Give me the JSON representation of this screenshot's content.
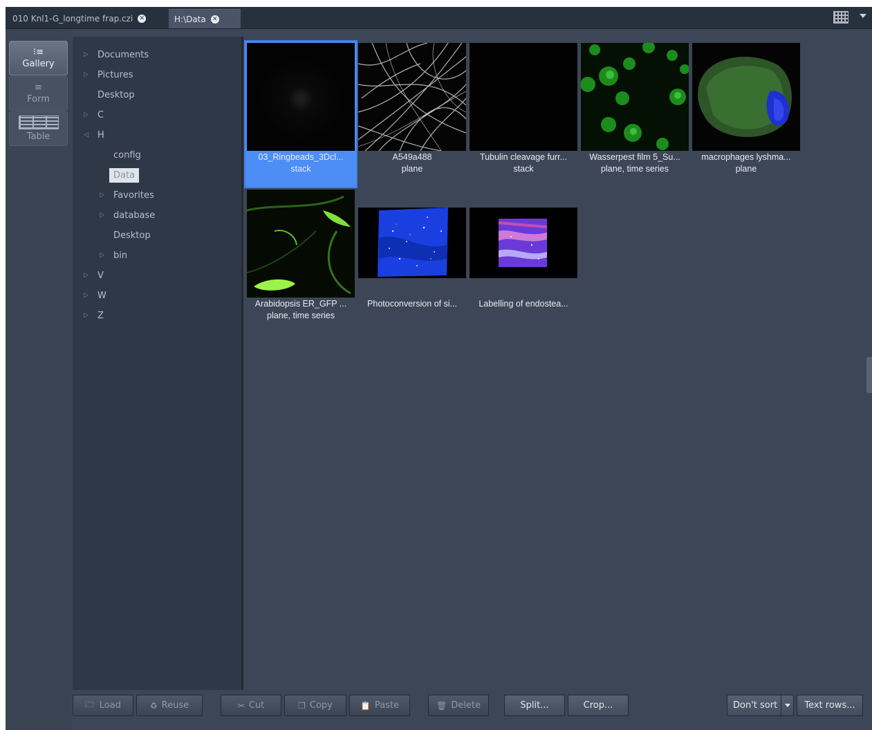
{
  "tabs": [
    {
      "label": "010 Knl1-G_longtime frap.czi"
    },
    {
      "label": "H:\\Data"
    }
  ],
  "view_modes": [
    {
      "label": "Gallery"
    },
    {
      "label": "Form"
    },
    {
      "label": "Table"
    }
  ],
  "tree": {
    "items": [
      {
        "label": "Documents"
      },
      {
        "label": "Pictures"
      },
      {
        "label": "Desktop"
      },
      {
        "label": "C"
      },
      {
        "label": "H"
      },
      {
        "label": "config"
      },
      {
        "label": "Data"
      },
      {
        "label": "Favorites"
      },
      {
        "label": "database"
      },
      {
        "label": "Desktop"
      },
      {
        "label": "bin"
      },
      {
        "label": "V"
      },
      {
        "label": "W"
      },
      {
        "label": "Z"
      }
    ]
  },
  "gallery": {
    "items": [
      {
        "name": "03_Ringbeads_3Dcl...",
        "type": "stack"
      },
      {
        "name": "A549a488",
        "type": "plane"
      },
      {
        "name": "Tubulin cleavage furr...",
        "type": "stack"
      },
      {
        "name": "Wasserpest film 5_Su...",
        "type": "plane, time series"
      },
      {
        "name": "macrophages lyshma...",
        "type": "plane"
      },
      {
        "name": "Arabidopsis ER_GFP ...",
        "type": "plane, time series"
      },
      {
        "name": "Photoconversion of si...",
        "type": ""
      },
      {
        "name": "Labelling of endostea...",
        "type": ""
      }
    ]
  },
  "toolbar": {
    "load": "Load",
    "reuse": "Reuse",
    "cut": "Cut",
    "copy": "Copy",
    "paste": "Paste",
    "delete": "Delete",
    "split": "Split...",
    "crop": "Crop...",
    "sort": "Don't sort",
    "text_rows": "Text rows..."
  },
  "colors": {
    "selection": "#4c8ef5",
    "panel": "#3d4656",
    "tree_bg": "#2f3847"
  }
}
